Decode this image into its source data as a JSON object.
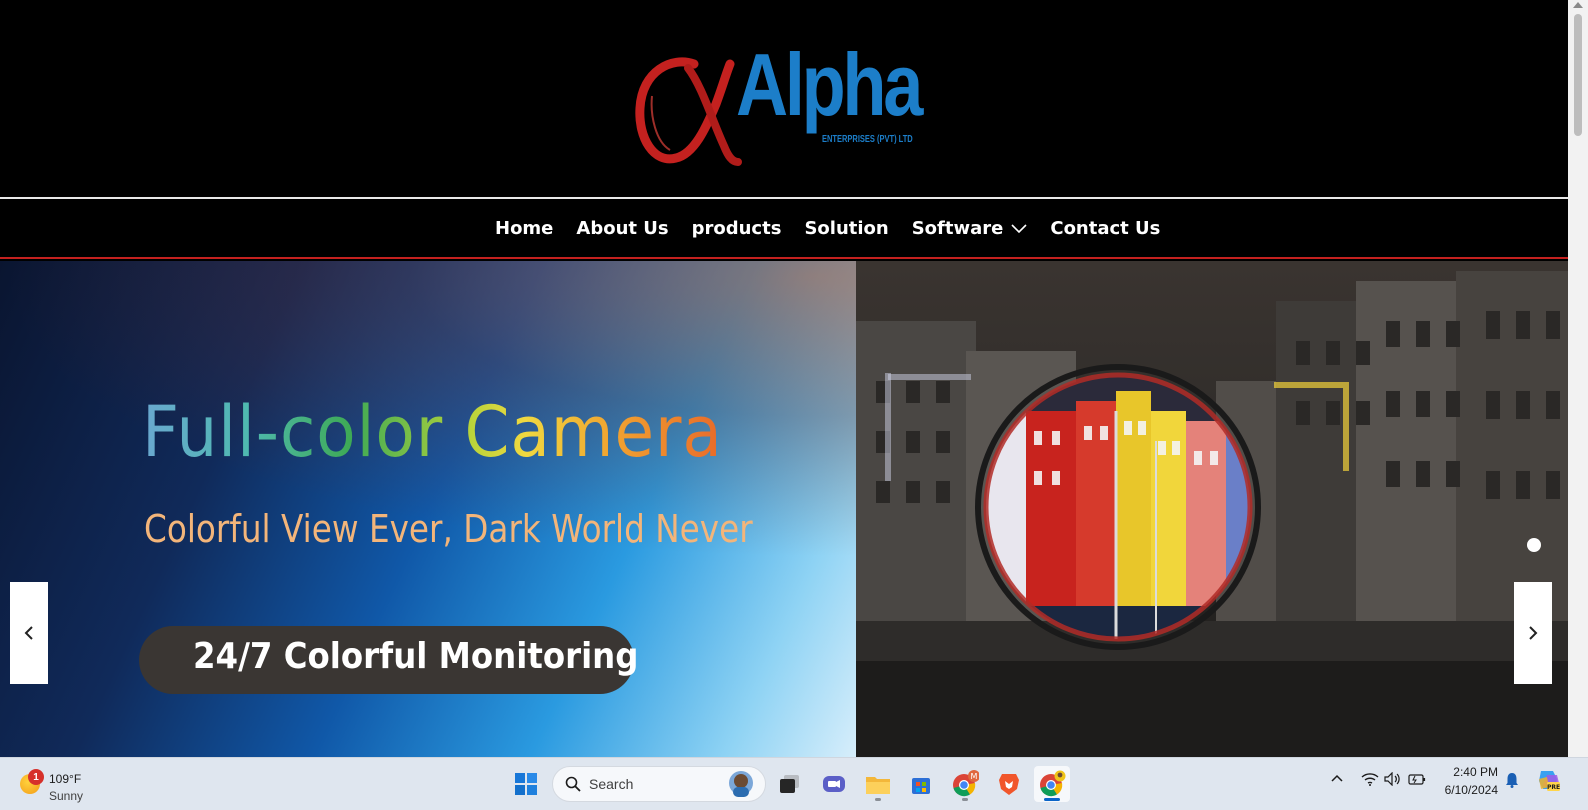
{
  "brand": {
    "name": "Alpha",
    "subtitle": "ENTERPRISES (PVT) LTD"
  },
  "nav": {
    "items": [
      {
        "label": "Home"
      },
      {
        "label": "About Us"
      },
      {
        "label": "products"
      },
      {
        "label": "Solution"
      },
      {
        "label": "Software"
      },
      {
        "label": "Contact Us"
      }
    ]
  },
  "hero": {
    "title": "Full-color  Camera",
    "subtitle": "Colorful View Ever, Dark World Never",
    "badge": "24/7 Colorful Monitoring"
  },
  "colors": {
    "brand_blue": "#1c7ec9",
    "brand_red": "#c4211f",
    "nav_bg": "#000000"
  },
  "taskbar": {
    "weather": {
      "temp": "109°F",
      "condition": "Sunny",
      "badge": "1"
    },
    "search": {
      "placeholder": "Search"
    },
    "pinned": [
      {
        "name": "start-icon"
      },
      {
        "name": "task-view-icon"
      },
      {
        "name": "meet-icon"
      },
      {
        "name": "file-explorer-icon"
      },
      {
        "name": "microsoft-store-icon"
      },
      {
        "name": "chrome-icon",
        "badge": "M"
      },
      {
        "name": "brave-icon"
      },
      {
        "name": "chrome-profile-icon"
      }
    ],
    "clock": {
      "time": "2:40 PM",
      "date": "6/10/2024"
    }
  }
}
